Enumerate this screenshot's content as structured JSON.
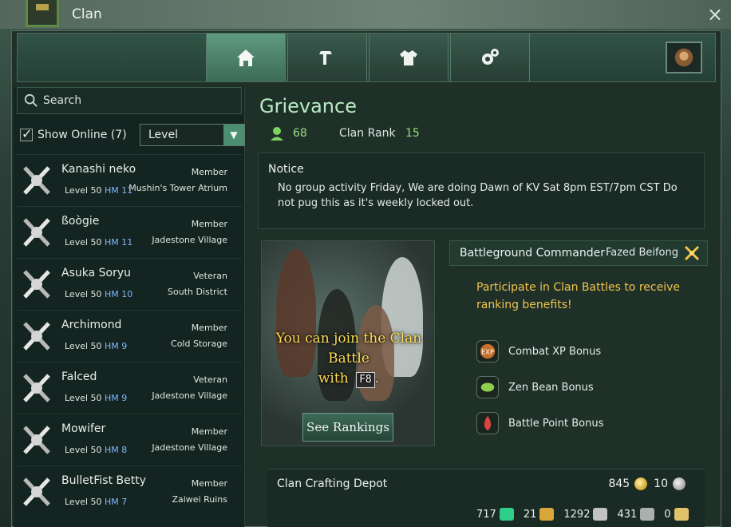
{
  "window": {
    "title": "Clan",
    "close_label": "×"
  },
  "tabs": [
    {
      "id": "home",
      "icon": "home-icon"
    },
    {
      "id": "craft",
      "icon": "hammer-icon"
    },
    {
      "id": "outfit",
      "icon": "outfit-icon"
    },
    {
      "id": "settings",
      "icon": "gear-icon"
    }
  ],
  "sidebar": {
    "search_placeholder": "Search",
    "show_online_label": "Show Online (7)",
    "sort_selected": "Level",
    "members": [
      {
        "name": "Kanashi neko",
        "role": "Member",
        "level": "Level 50",
        "hm": "HM 11",
        "location": "Mushin's Tower Atrium"
      },
      {
        "name": "ßoògie",
        "role": "Member",
        "level": "Level 50",
        "hm": "HM 11",
        "location": "Jadestone Village"
      },
      {
        "name": "Asuka Soryu",
        "role": "Veteran",
        "level": "Level 50",
        "hm": "HM 10",
        "location": "South District"
      },
      {
        "name": "Archimond",
        "role": "Member",
        "level": "Level 50",
        "hm": "HM 9",
        "location": "Cold Storage"
      },
      {
        "name": "Falced",
        "role": "Veteran",
        "level": "Level 50",
        "hm": "HM 9",
        "location": "Jadestone Village"
      },
      {
        "name": "Mowifer",
        "role": "Member",
        "level": "Level 50",
        "hm": "HM 8",
        "location": "Jadestone Village"
      },
      {
        "name": "BulletFist Betty",
        "role": "Member",
        "level": "Level 50",
        "hm": "HM 7",
        "location": "Zaiwei Ruins"
      }
    ]
  },
  "clan": {
    "name": "Grievance",
    "member_count": "68",
    "rank_label": "Clan Rank",
    "rank_value": "15",
    "notice_title": "Notice",
    "notice_text": "No group activity Friday, We are doing Dawn of KV Sat 8pm EST/7pm CST Do not pug this as it's weekly locked out.",
    "battle_text_line1": "You can join the Clan",
    "battle_text_line2": "Battle",
    "battle_text_with": "with",
    "battle_key": "F8",
    "battle_text_end": ".",
    "rankings_button": "See Rankings",
    "commander_label": "Battleground Commander",
    "commander_name": "Fazed Beifong",
    "benefits_intro": "Participate in Clan Battles to receive ranking benefits!",
    "benefits": [
      {
        "label": "Combat XP Bonus",
        "icon": "exp-icon"
      },
      {
        "label": "Zen Bean Bonus",
        "icon": "zen-bean-icon"
      },
      {
        "label": "Battle Point Bonus",
        "icon": "battle-point-icon"
      }
    ]
  },
  "crafting": {
    "title": "Clan Crafting Depot",
    "gold": "845",
    "silver": "10",
    "materials": [
      "717",
      "21",
      "1292",
      "431",
      "0"
    ]
  },
  "colors": {
    "accent_green": "#90e07a",
    "notice_gold": "#f1c44a",
    "hm_blue": "#7fb6ff"
  }
}
